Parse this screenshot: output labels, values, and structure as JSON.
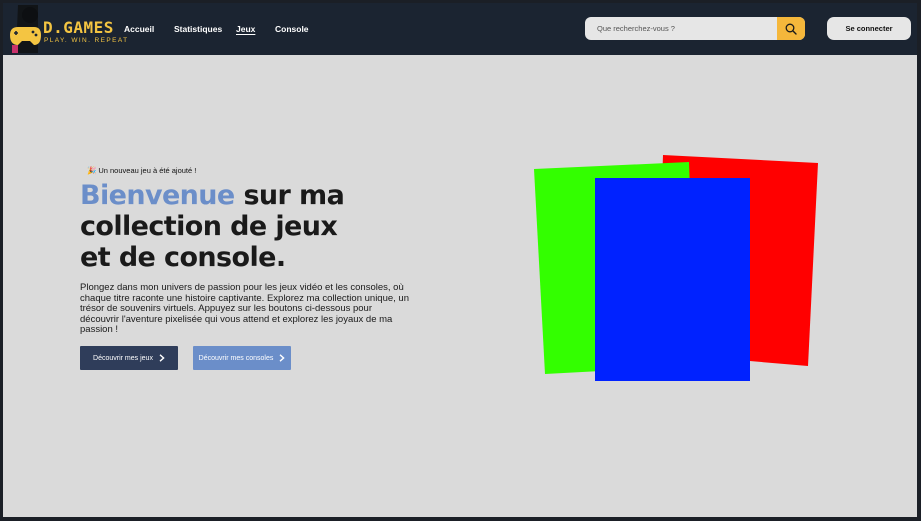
{
  "header": {
    "brand": "D.GAMES",
    "tagline": "PLAY. WIN. REPEAT",
    "nav": [
      {
        "label": "Accueil",
        "active": false
      },
      {
        "label": "Statistiques",
        "active": false
      },
      {
        "label": "Jeux",
        "active": true
      },
      {
        "label": "Console",
        "active": false
      }
    ],
    "search": {
      "placeholder": "Que recherchez-vous ?",
      "value": "",
      "icon": "search-icon"
    },
    "login_label": "Se connecter"
  },
  "hero": {
    "announcement": "Un nouveau jeu à été ajouté !",
    "announcement_icon": "party-popper-icon",
    "title_accent": "Bienvenue",
    "title_rest_1": " sur ma",
    "title_line_2": "collection de jeux",
    "title_line_3": "et de console.",
    "description": "Plongez dans mon univers de passion pour les jeux vidéo et les consoles, où chaque titre raconte une histoire captivante. Explorez ma collection unique, un trésor de souvenirs virtuels. Appuyez sur les boutons ci-dessous pour découvrir l'aventure pixelisée qui vous attend et explorez les joyaux de ma passion !",
    "primary_button": "Découvrir mes jeux",
    "secondary_button": "Découvrir mes consoles"
  },
  "colors": {
    "navbar": "#1b2431",
    "brand": "#f4c542",
    "accent": "#6b8ec9",
    "primary_button": "#2f3d5a",
    "search_button": "#f5b73b",
    "background": "#dadada",
    "card_red": "#ff0000",
    "card_green": "#33ff00",
    "card_blue": "#0022ff"
  }
}
